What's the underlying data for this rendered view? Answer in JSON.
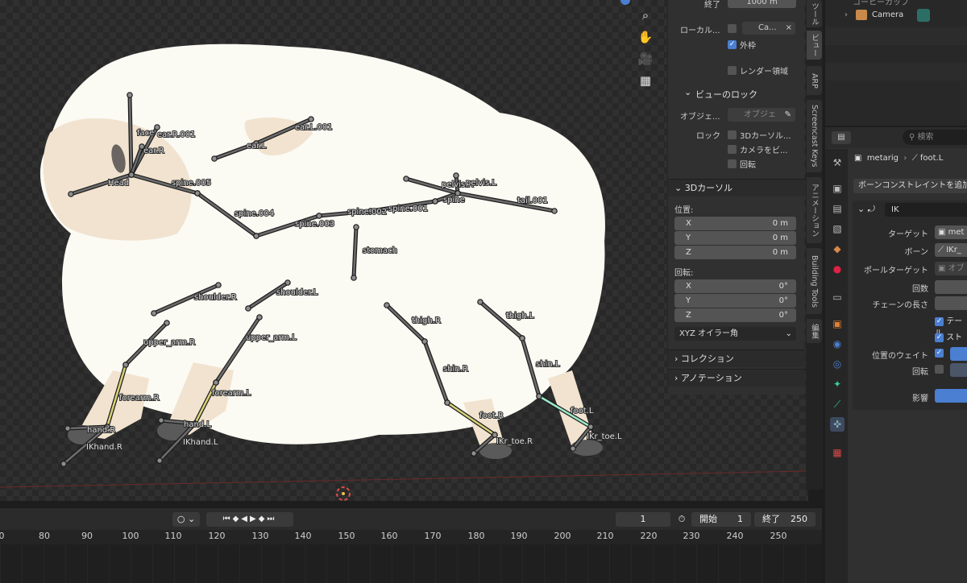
{
  "viewport": {
    "bones": [
      {
        "name": "Head",
        "label": "Head"
      },
      {
        "name": "face",
        "label": "face"
      },
      {
        "name": "ear-r-001",
        "label": "ear.R.001"
      },
      {
        "name": "ear-r",
        "label": "ear.R"
      },
      {
        "name": "ear-l",
        "label": "ear.L"
      },
      {
        "name": "ear-l-001",
        "label": "ear.L.001"
      },
      {
        "name": "spine-005",
        "label": "spine.005"
      },
      {
        "name": "spine-004",
        "label": "spine.004"
      },
      {
        "name": "spine-003",
        "label": "spine.003"
      },
      {
        "name": "spine-002",
        "label": "spine.002"
      },
      {
        "name": "spine-001",
        "label": "spine.001"
      },
      {
        "name": "spine",
        "label": "spine"
      },
      {
        "name": "pelvis-r",
        "label": "pelvis.R"
      },
      {
        "name": "pelvis-l",
        "label": "pelvis.L"
      },
      {
        "name": "tail-001",
        "label": "tail.001"
      },
      {
        "name": "stomach",
        "label": "stomach"
      },
      {
        "name": "shoulder-r",
        "label": "shoulder.R"
      },
      {
        "name": "shoulder-l",
        "label": "shoulder.L"
      },
      {
        "name": "upper-arm-r",
        "label": "upper_arm.R"
      },
      {
        "name": "upper-arm-l",
        "label": "upper_arm.L"
      },
      {
        "name": "forearm-r",
        "label": "forearm.R"
      },
      {
        "name": "forearm-l",
        "label": "forearm.L"
      },
      {
        "name": "hand-r",
        "label": "hand.R"
      },
      {
        "name": "hand-l",
        "label": "hand.L"
      },
      {
        "name": "ikhand-r",
        "label": "IKhand.R"
      },
      {
        "name": "ikhand-l",
        "label": "IKhand.L"
      },
      {
        "name": "thigh-r",
        "label": "thigh.R"
      },
      {
        "name": "thigh-l",
        "label": "thigh.L"
      },
      {
        "name": "shin-r",
        "label": "shin.R"
      },
      {
        "name": "shin-l",
        "label": "shin.L"
      },
      {
        "name": "foot-r",
        "label": "foot.R"
      },
      {
        "name": "foot-l",
        "label": "foot.L"
      },
      {
        "name": "ikr-toe-r",
        "label": "IKr_toe.R"
      },
      {
        "name": "ikr-toe-l",
        "label": "IKr_toe.L"
      }
    ],
    "nav_icons": [
      "zoom-icon",
      "hand-icon",
      "camera-icon",
      "grid-icon"
    ]
  },
  "npanel": {
    "clip_end_label": "終了",
    "clip_end_value": "1000 m",
    "local_camera_label": "ローカル...",
    "local_camera_value": "Ca...",
    "outline_label": "外枠",
    "render_region_label": "レンダー領域",
    "view_lock_header": "ビューのロック",
    "object_label": "オブジェ...",
    "object_placeholder": "オブジェ",
    "lock_label": "ロック",
    "lock_cursor": "3Dカーソル...",
    "lock_camera": "カメラをビ...",
    "lock_rotation": "回転",
    "cursor_header": "3Dカーソル",
    "location_label": "位置:",
    "location": [
      {
        "axis": "X",
        "value": "0 m"
      },
      {
        "axis": "Y",
        "value": "0 m"
      },
      {
        "axis": "Z",
        "value": "0 m"
      }
    ],
    "rotation_label": "回転:",
    "rotation": [
      {
        "axis": "X",
        "value": "0°"
      },
      {
        "axis": "Y",
        "value": "0°"
      },
      {
        "axis": "Z",
        "value": "0°"
      }
    ],
    "rotation_mode": "XYZ オイラー角",
    "collection_header": "コレクション",
    "annotation_header": "アノテーション"
  },
  "ntabs": [
    "ツール",
    "ビュー",
    "ARP",
    "Screencast Keys",
    "アニメーション",
    "Building Tools",
    "編集"
  ],
  "outliner": {
    "item_label": "Camera",
    "partial_label": "コーヒーカップ"
  },
  "properties": {
    "search_placeholder": "検索",
    "breadcrumb_object": "metarig",
    "breadcrumb_bone": "foot.L",
    "add_constraint": "ボーンコンストレイントを追加",
    "constraint_name": "IK",
    "target_label": "ターゲット",
    "target_value": "met",
    "bone_label": "ボーン",
    "bone_value": "IKr_",
    "pole_label": "ポールターゲット",
    "pole_value": "オブ",
    "iterations_label": "回数",
    "chain_label": "チェーンの長さ",
    "use_tail_label": "テール",
    "stretch_label": "スト",
    "position_weight_label": "位置のウェイト",
    "rotation_label": "回転",
    "influence_label": "影響"
  },
  "timeline": {
    "current_frame": "1",
    "start_label": "開始",
    "start_value": "1",
    "end_label": "終了",
    "end_value": "250",
    "ruler": [
      "0",
      "80",
      "90",
      "100",
      "110",
      "120",
      "130",
      "140",
      "150",
      "160",
      "170",
      "180",
      "190",
      "200",
      "210",
      "220",
      "230",
      "240",
      "250"
    ]
  },
  "colors": {
    "accent": "#4a7fd1",
    "sheep": "#fbfaf3",
    "bone": "#6c6c6c",
    "ik_highlight": "#9be8c8",
    "chain_yellow": "#d8d27a"
  }
}
